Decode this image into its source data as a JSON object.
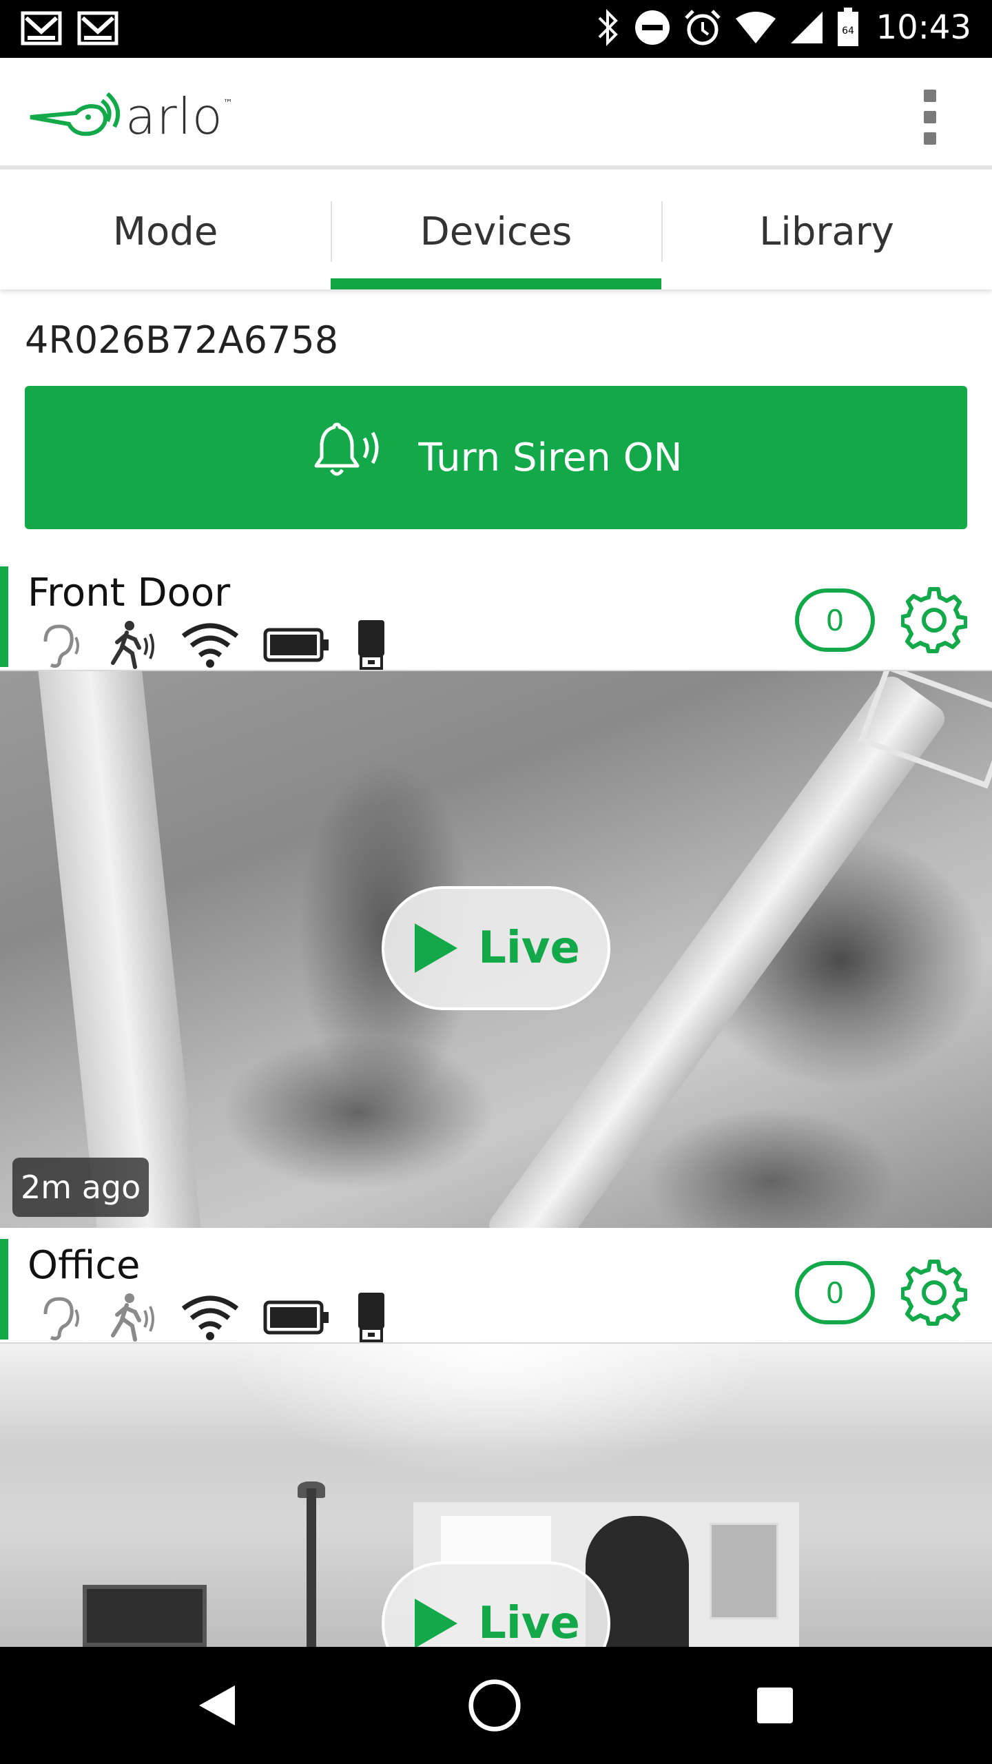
{
  "status_bar": {
    "time": "10:43",
    "icons": [
      "gmail-icon",
      "gmail-icon",
      "bluetooth-icon",
      "do-not-disturb-icon",
      "alarm-icon",
      "wifi-icon",
      "cell-signal-icon",
      "battery-icon"
    ]
  },
  "app_bar": {
    "logo_text": "arlo",
    "logo_tm": "™",
    "menu_icon": "more-vert-icon"
  },
  "tabs": [
    {
      "label": "Mode",
      "active": false
    },
    {
      "label": "Devices",
      "active": true
    },
    {
      "label": "Library",
      "active": false
    }
  ],
  "base_station": {
    "id": "4R026B72A6758"
  },
  "siren": {
    "label": "Turn Siren ON",
    "icon": "bell-ringing-icon"
  },
  "cameras": [
    {
      "name": "Front Door",
      "count": "0",
      "live_label": "Live",
      "last_seen": "2m ago",
      "status_icons": [
        "audio-detection-icon",
        "motion-detection-icon",
        "wifi-signal-icon",
        "battery-icon",
        "usb-storage-icon"
      ]
    },
    {
      "name": "Office",
      "count": "0",
      "live_label": "Live",
      "status_icons": [
        "audio-detection-icon",
        "motion-detection-icon",
        "wifi-signal-icon",
        "battery-icon",
        "usb-storage-icon"
      ]
    }
  ],
  "colors": {
    "brand_green": "#13a84a",
    "text_dark": "#222222"
  },
  "nav_bar": {
    "items": [
      "back-icon",
      "home-icon",
      "recents-icon"
    ]
  }
}
